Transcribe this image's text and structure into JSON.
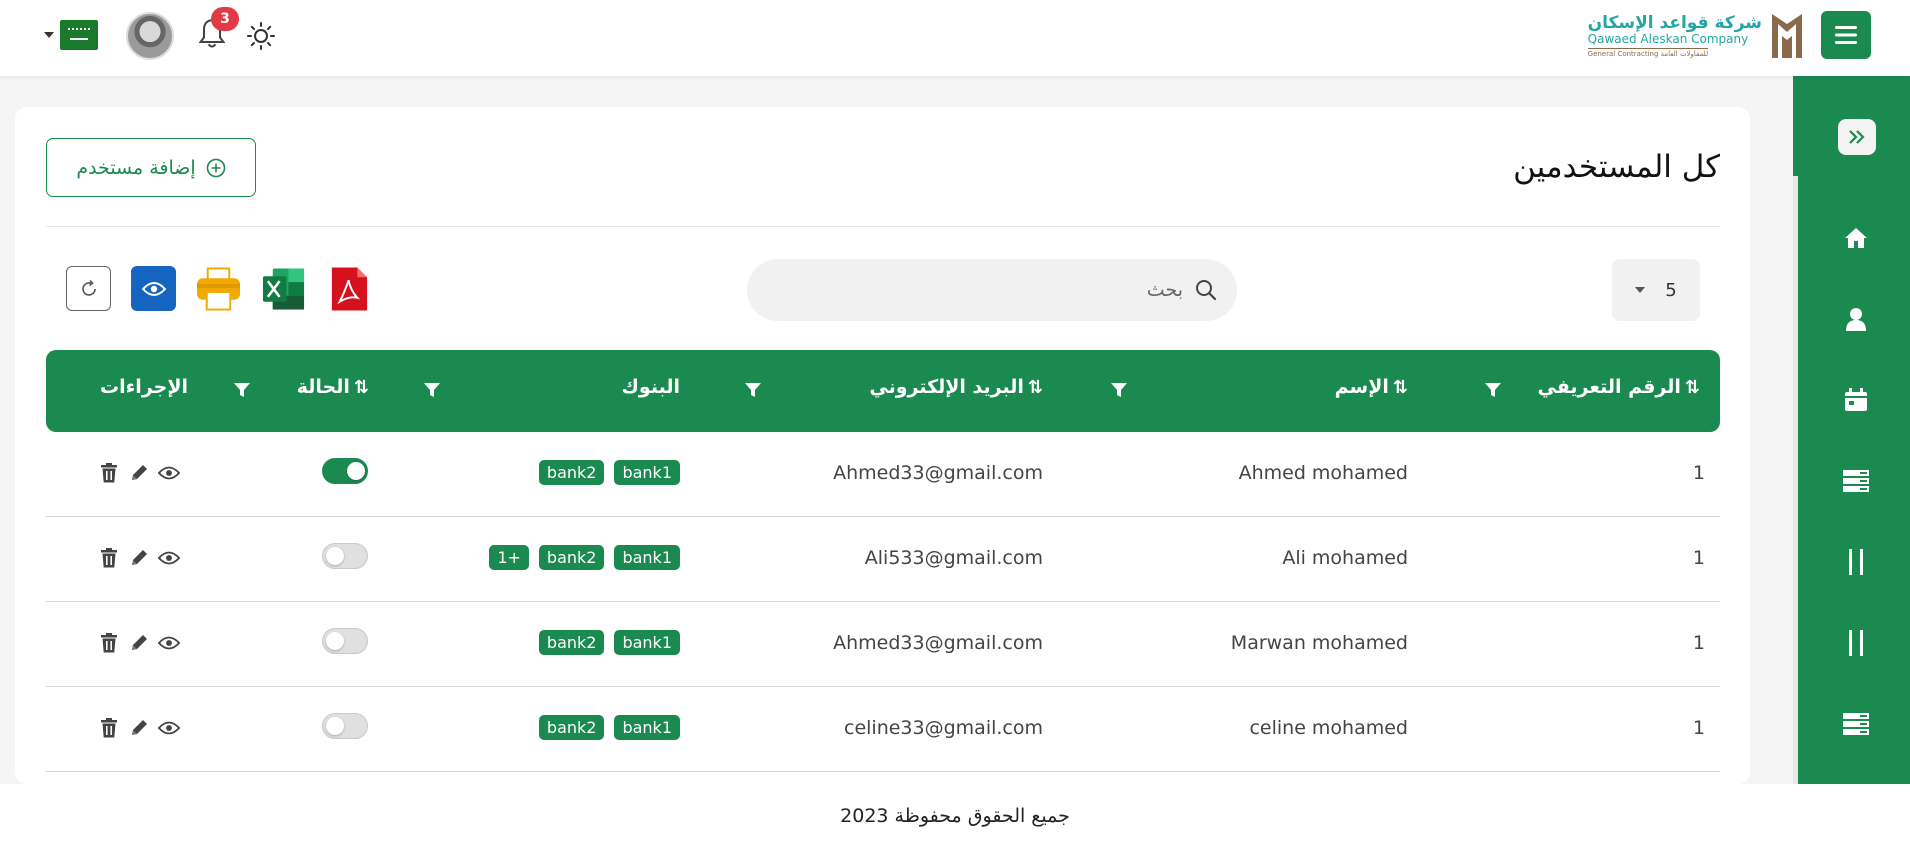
{
  "topbar": {
    "notification_count": "3",
    "logo_arabic": "شركة قواعد الإسكان",
    "logo_english": "Qawaed Aleskan Company",
    "logo_sub_en": "General Contracting",
    "logo_sub_ar": "للمقاولات العامة"
  },
  "page": {
    "title": "كل المستخدمين",
    "add_user_label": "إضافة مستخدم",
    "page_size": "5",
    "search_placeholder": "بحث"
  },
  "table": {
    "headers": {
      "id": "الرقم التعريفي",
      "name": "الإسم",
      "email": "البريد الإلكتروني",
      "banks": "البنوك",
      "status": "الحالة",
      "actions": "الإجراءات"
    },
    "rows": [
      {
        "id": "1",
        "name": "Ahmed mohamed",
        "email": "Ahmed33@gmail.com",
        "banks": [
          "bank1",
          "bank2"
        ],
        "extra": "",
        "status": true
      },
      {
        "id": "1",
        "name": "Ali mohamed",
        "email": "Ali533@gmail.com",
        "banks": [
          "bank1",
          "bank2"
        ],
        "extra": "1+",
        "status": false
      },
      {
        "id": "1",
        "name": "Marwan mohamed",
        "email": "Ahmed33@gmail.com",
        "banks": [
          "bank1",
          "bank2"
        ],
        "extra": "",
        "status": false
      },
      {
        "id": "1",
        "name": "celine mohamed",
        "email": "celine33@gmail.com",
        "banks": [
          "bank1",
          "bank2"
        ],
        "extra": "",
        "status": false
      }
    ]
  },
  "footer": {
    "copyright": "جميع الحقوق محفوظة 2023"
  },
  "colors": {
    "primary": "#1b8a51",
    "badge": "#e23b45",
    "eye_button": "#1565c0"
  },
  "icons": [
    "menu-icon",
    "sun-icon",
    "bell-icon",
    "avatar",
    "flag-icon",
    "chevron-double-right-icon",
    "home-icon",
    "user-icon",
    "calendar-icon",
    "list-icon",
    "pause-icon",
    "refresh-icon",
    "eye-icon",
    "print-icon",
    "excel-icon",
    "pdf-icon",
    "search-icon",
    "filter-icon",
    "sort-icon",
    "trash-icon",
    "pencil-icon"
  ]
}
